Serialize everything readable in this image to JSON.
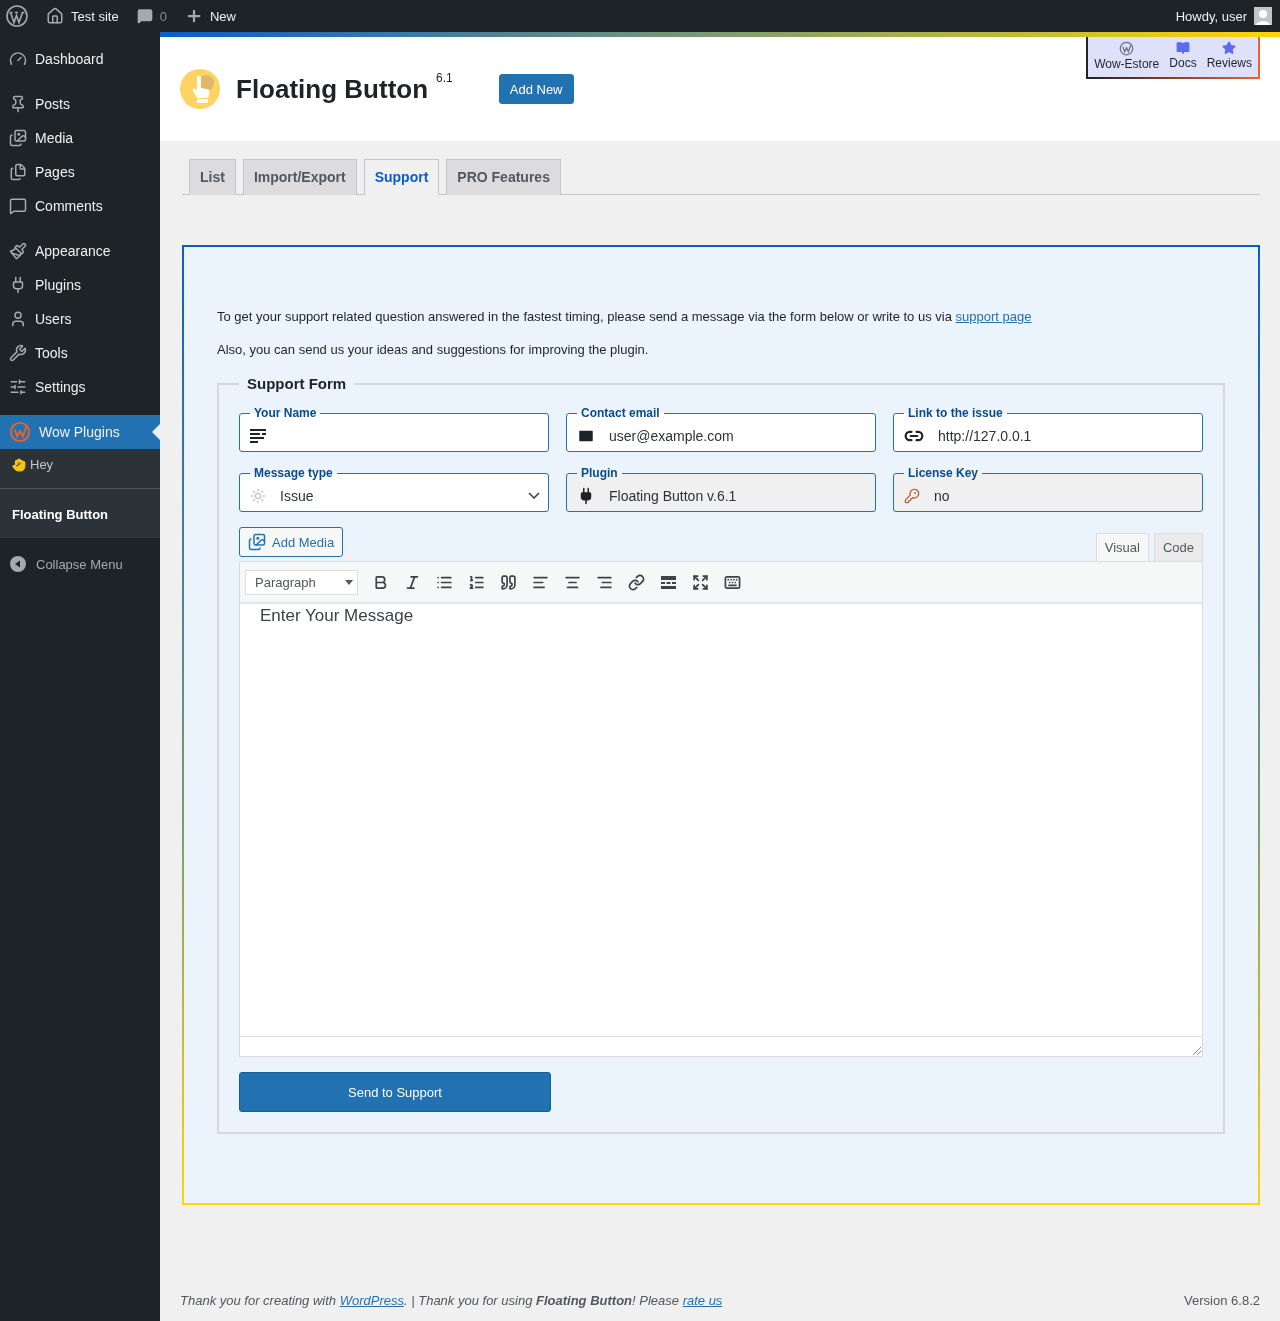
{
  "admin_bar": {
    "site": "Test site",
    "comments": "0",
    "new": "New",
    "greeting": "Howdy, user"
  },
  "sidebar": {
    "groups": [
      {
        "items": [
          {
            "label": "Dashboard",
            "selected": false
          }
        ]
      },
      {
        "items": [
          {
            "label": "Posts",
            "selected": false
          },
          {
            "label": "Media",
            "selected": false
          },
          {
            "label": "Pages",
            "selected": false
          },
          {
            "label": "Comments",
            "selected": false
          }
        ]
      },
      {
        "items": [
          {
            "label": "Appearance",
            "selected": false
          },
          {
            "label": "Plugins",
            "selected": false
          },
          {
            "label": "Users",
            "selected": false
          },
          {
            "label": "Tools",
            "selected": false
          },
          {
            "label": "Settings",
            "selected": false
          }
        ]
      },
      {
        "items": [
          {
            "label": "Wow Plugins",
            "selected": true,
            "children": [
              {
                "label": "Hey",
                "selected": false
              },
              {
                "label": "Floating Button",
                "selected": true
              }
            ]
          }
        ]
      }
    ],
    "collapse": "Collapse Menu"
  },
  "header": {
    "title": "Floating Button",
    "version": "6.1",
    "add_button": "Add New",
    "quick_links": [
      "Wow-Estore",
      "Docs",
      "Reviews"
    ]
  },
  "tabs": [
    {
      "label": "List",
      "selected": false
    },
    {
      "label": "Import/Export",
      "selected": false
    },
    {
      "label": "Support",
      "selected": true
    },
    {
      "label": "PRO Features",
      "selected": false
    }
  ],
  "support": {
    "intro": [
      {
        "kind": "text",
        "text": "To get your support related question answered in the fastest timing, please send a message via the form below or write to us via "
      },
      {
        "kind": "link",
        "text": "support page"
      }
    ],
    "note": "Also, you can send us your ideas and suggestions for improving the plugin.",
    "form": {
      "legend": "Support Form",
      "fields": [
        {
          "label": "Your Name",
          "kind": "text",
          "disabled": false
        },
        {
          "label": "Contact email",
          "kind": "text",
          "value": "user@example.com",
          "disabled": false
        },
        {
          "label": "Link to the issue",
          "kind": "text",
          "value": "http://127.0.0.1",
          "disabled": false
        },
        {
          "label": "Message type",
          "kind": "select",
          "value": "Issue",
          "disabled": false
        },
        {
          "label": "Plugin",
          "kind": "text",
          "value": "Floating Button v.6.1",
          "disabled": true
        },
        {
          "label": "License Key",
          "kind": "text",
          "value": "no",
          "disabled": true
        }
      ],
      "add_media": "Add Media",
      "editor": {
        "modes": [
          {
            "label": "Visual",
            "selected": true
          },
          {
            "label": "Code",
            "selected": false
          }
        ],
        "format": "Paragraph",
        "content": "Enter Your Message"
      },
      "submit": "Send to Support"
    }
  },
  "footer": {
    "credit": [
      {
        "kind": "text",
        "text": "Thank you for creating with "
      },
      {
        "kind": "link",
        "text": "WordPress"
      },
      {
        "kind": "text",
        "text": ". | Thank you for using **Floating Button**! Please "
      },
      {
        "kind": "link",
        "text": "rate us"
      }
    ],
    "version": "Version 6.8.2"
  }
}
